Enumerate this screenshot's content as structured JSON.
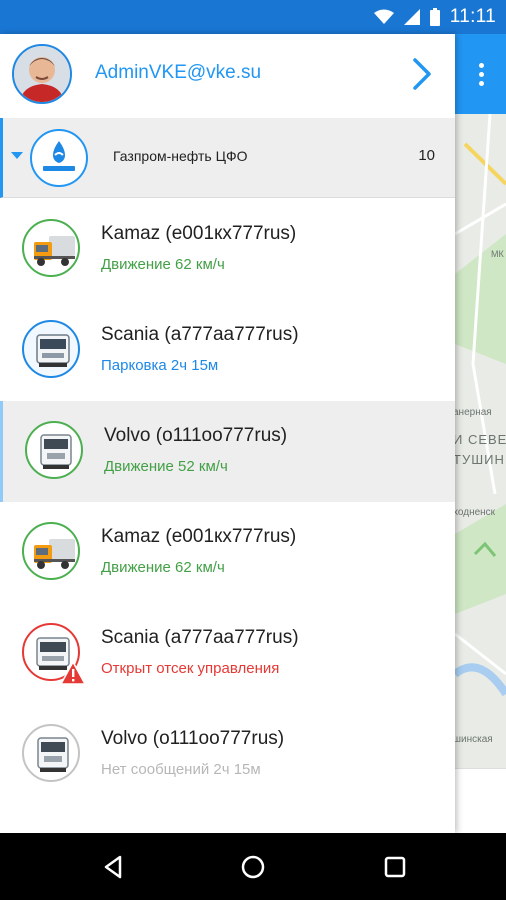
{
  "status_bar": {
    "time": "11:11",
    "icons": [
      "wifi-icon",
      "cellular-signal-icon",
      "battery-icon"
    ]
  },
  "account": {
    "email": "AdminVKE@vke.su",
    "icon": "chevron-right-icon"
  },
  "organization": {
    "name": "Газпром-нефть ЦФО",
    "count": "10",
    "logo_icon": "gazprom-neft-logo"
  },
  "vehicles": [
    {
      "name": "Kamaz (e001кх777rus)",
      "status": "Движение 62 км/ч",
      "status_color": "#43a047",
      "truck": "kamaz-orange",
      "ring": "green"
    },
    {
      "name": "Scania (a777aa777rus)",
      "status": "Парковка 2ч 15м",
      "status_color": "#1e88e5",
      "truck": "scania-white-on-blue",
      "ring": "blue"
    },
    {
      "name": "Volvo (o111oo777rus)",
      "status": "Движение 52 км/ч",
      "status_color": "#43a047",
      "truck": "volvo-white",
      "ring": "green"
    },
    {
      "name": "Kamaz (e001кх777rus)",
      "status": "Движение 62 км/ч",
      "status_color": "#43a047",
      "truck": "kamaz-orange",
      "ring": "green"
    },
    {
      "name": "Scania (a777aa777rus)",
      "status": "Открыт отсек управления",
      "status_color": "#e53935",
      "truck": "scania-white",
      "ring": "red",
      "alert_icon": "warning-triangle-icon"
    },
    {
      "name": "Volvo (o111oo777rus)",
      "status": "Нет сообщений 2ч 15м",
      "status_color": "#b7b7b7",
      "truck": "volvo-white",
      "ring": "gray"
    }
  ],
  "map": {
    "labels": [
      "анерная",
      "И СЕВЕ",
      "ТУШИН",
      "ходненск",
      "шинская",
      "МК"
    ]
  },
  "colors": {
    "primary": "#2196f3",
    "status_bar": "#1976d2",
    "moving": "#43a047",
    "parking": "#1e88e5",
    "alert": "#e53935",
    "stale": "#b7b7b7"
  },
  "nav_bar": {
    "icons": [
      "back-triangle-icon",
      "home-circle-icon",
      "recents-square-icon"
    ]
  }
}
